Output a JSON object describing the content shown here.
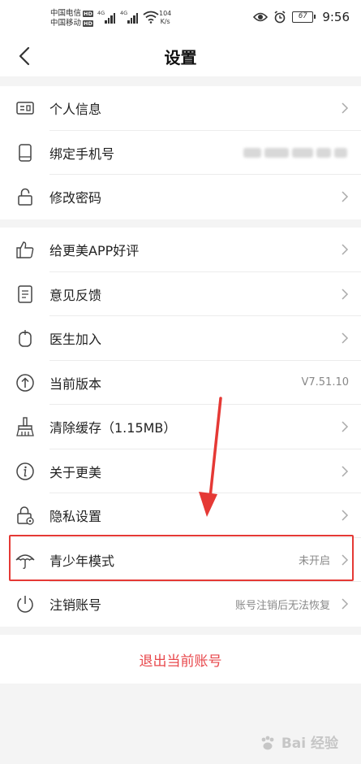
{
  "status_bar": {
    "carrier1": "中国电信",
    "carrier2": "中国移动",
    "hd": "HD",
    "network": "4G",
    "speed_value": "104",
    "speed_unit": "K/s",
    "battery": "67",
    "time": "9:56"
  },
  "header": {
    "title": "设置"
  },
  "group1": [
    {
      "label": "个人信息",
      "icon": "id-card-icon",
      "value": ""
    },
    {
      "label": "绑定手机号",
      "icon": "phone-icon",
      "value": ""
    },
    {
      "label": "修改密码",
      "icon": "lock-icon",
      "value": ""
    }
  ],
  "group2": [
    {
      "label": "给更美APP好评",
      "icon": "thumbs-up-icon",
      "value": ""
    },
    {
      "label": "意见反馈",
      "icon": "feedback-icon",
      "value": ""
    },
    {
      "label": "医生加入",
      "icon": "doctor-icon",
      "value": ""
    },
    {
      "label": "当前版本",
      "icon": "upload-icon",
      "value": "V7.51.10"
    },
    {
      "label": "清除缓存（1.15MB）",
      "icon": "broom-icon",
      "value": ""
    },
    {
      "label": "关于更美",
      "icon": "info-icon",
      "value": ""
    },
    {
      "label": "隐私设置",
      "icon": "privacy-lock-icon",
      "value": ""
    },
    {
      "label": "青少年模式",
      "icon": "umbrella-icon",
      "value": "未开启"
    },
    {
      "label": "注销账号",
      "icon": "power-icon",
      "value": "账号注销后无法恢复"
    }
  ],
  "logout": {
    "label": "退出当前账号"
  },
  "watermark": "Bai 经验",
  "colors": {
    "accent_red": "#e8484c",
    "highlight": "#e53935"
  }
}
